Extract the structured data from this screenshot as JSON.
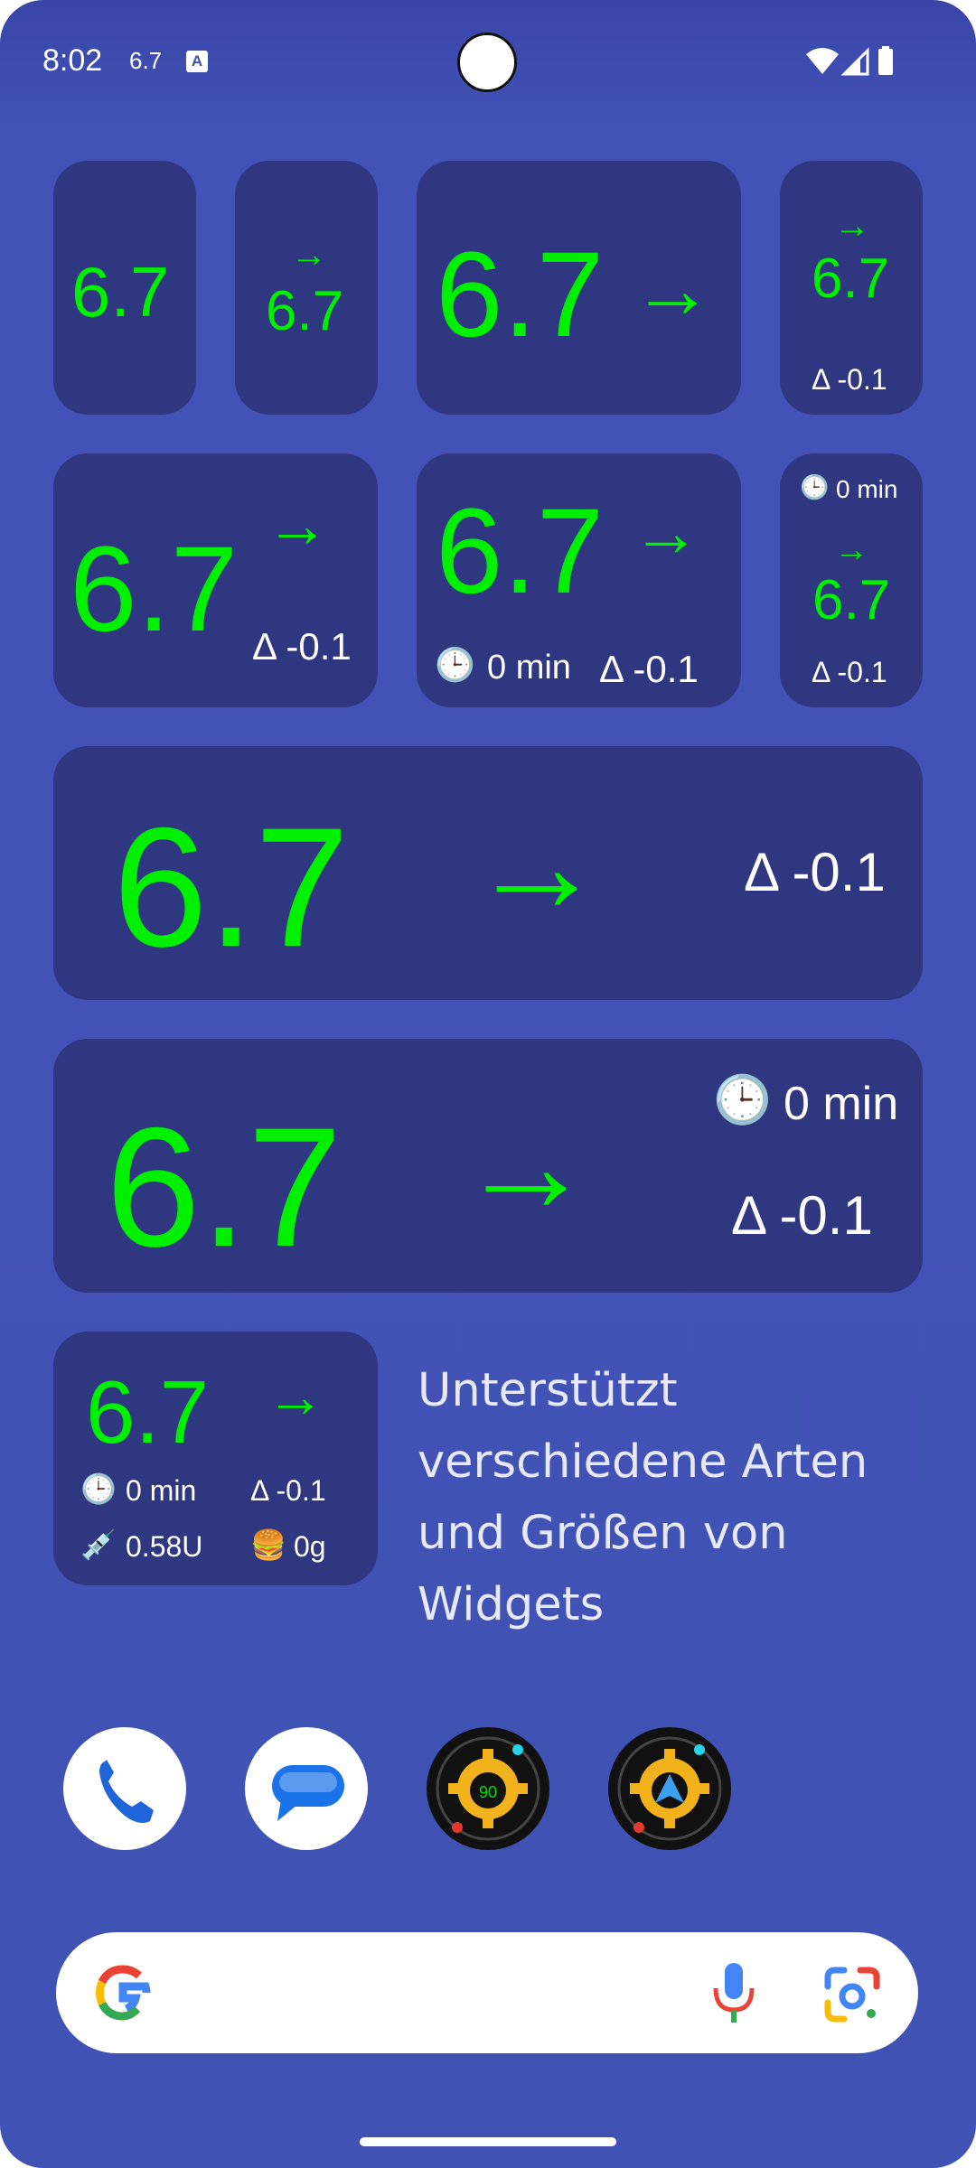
{
  "status_bar": {
    "time": "8:02",
    "glucose_value": "6.7",
    "notification_icon": "A"
  },
  "widgets": {
    "w1": {
      "value": "6.7"
    },
    "w2": {
      "arrow": "→",
      "value": "6.7"
    },
    "w3": {
      "value": "6.7",
      "arrow": "→"
    },
    "w4": {
      "arrow": "→",
      "value": "6.7",
      "delta": "Δ -0.1"
    },
    "w5": {
      "value": "6.7",
      "arrow": "→",
      "delta": "Δ -0.1"
    },
    "w6": {
      "value": "6.7",
      "arrow": "→",
      "clock": "🕒",
      "time": "0 min",
      "delta": "Δ -0.1"
    },
    "w7": {
      "clock": "🕒",
      "time": "0 min",
      "arrow": "→",
      "value": "6.7",
      "delta": "Δ -0.1"
    },
    "w8": {
      "value": "6.7",
      "arrow": "→",
      "delta": "Δ -0.1"
    },
    "w9": {
      "value": "6.7",
      "arrow": "→",
      "clock": "🕒",
      "time": "0 min",
      "delta": "Δ -0.1"
    },
    "w10": {
      "value": "6.7",
      "arrow": "→",
      "clock": "🕒",
      "time": "0 min",
      "delta": "Δ -0.1",
      "syringe": "💉",
      "insulin": "0.58U",
      "burger": "🍔",
      "carbs": "0g"
    }
  },
  "description": "Unterstützt verschiedene Arten und Größen von Widgets",
  "dock": {
    "app3_badge": "90"
  },
  "colors": {
    "background": "#4152b5",
    "widget_bg": "#2e3780",
    "glucose_green": "#00f000"
  }
}
